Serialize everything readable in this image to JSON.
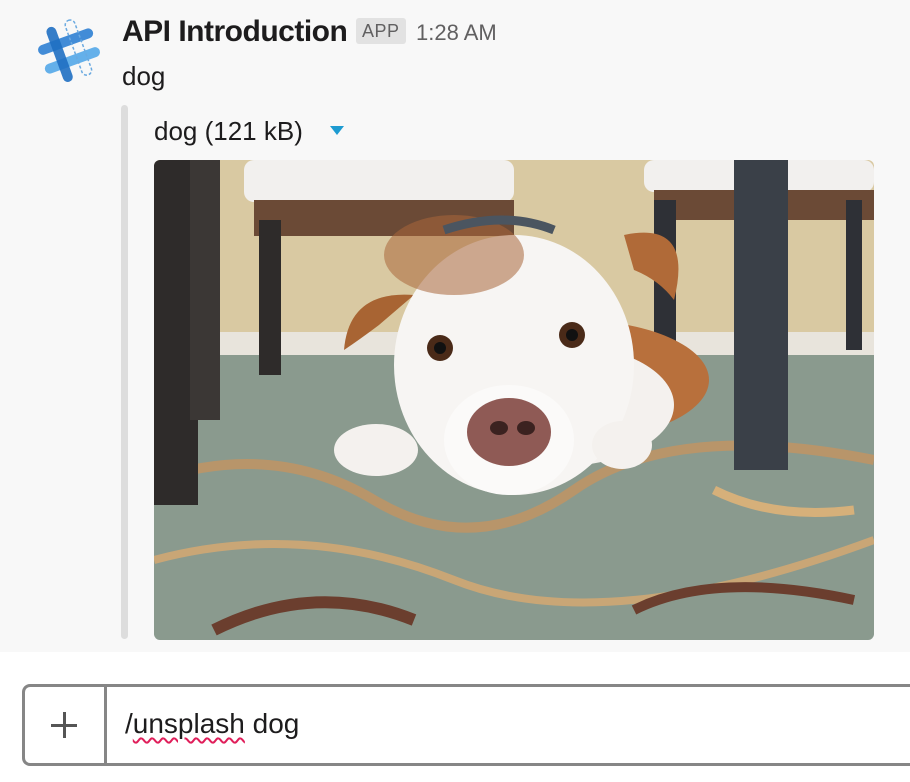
{
  "message": {
    "sender": "API Introduction",
    "badge": "APP",
    "timestamp": "1:28 AM",
    "text": "dog",
    "attachment": {
      "title": "dog (121 kB)",
      "caret_icon": "caret-down-icon",
      "image_subject": "dog-photo"
    }
  },
  "composer": {
    "add_icon": "plus-icon",
    "input_prefix": "/",
    "input_misspelled": "unsplash",
    "input_rest": " dog"
  },
  "colors": {
    "accent": "#1d9bd1",
    "spellcheck": "#e01e5a",
    "border": "#868686"
  }
}
